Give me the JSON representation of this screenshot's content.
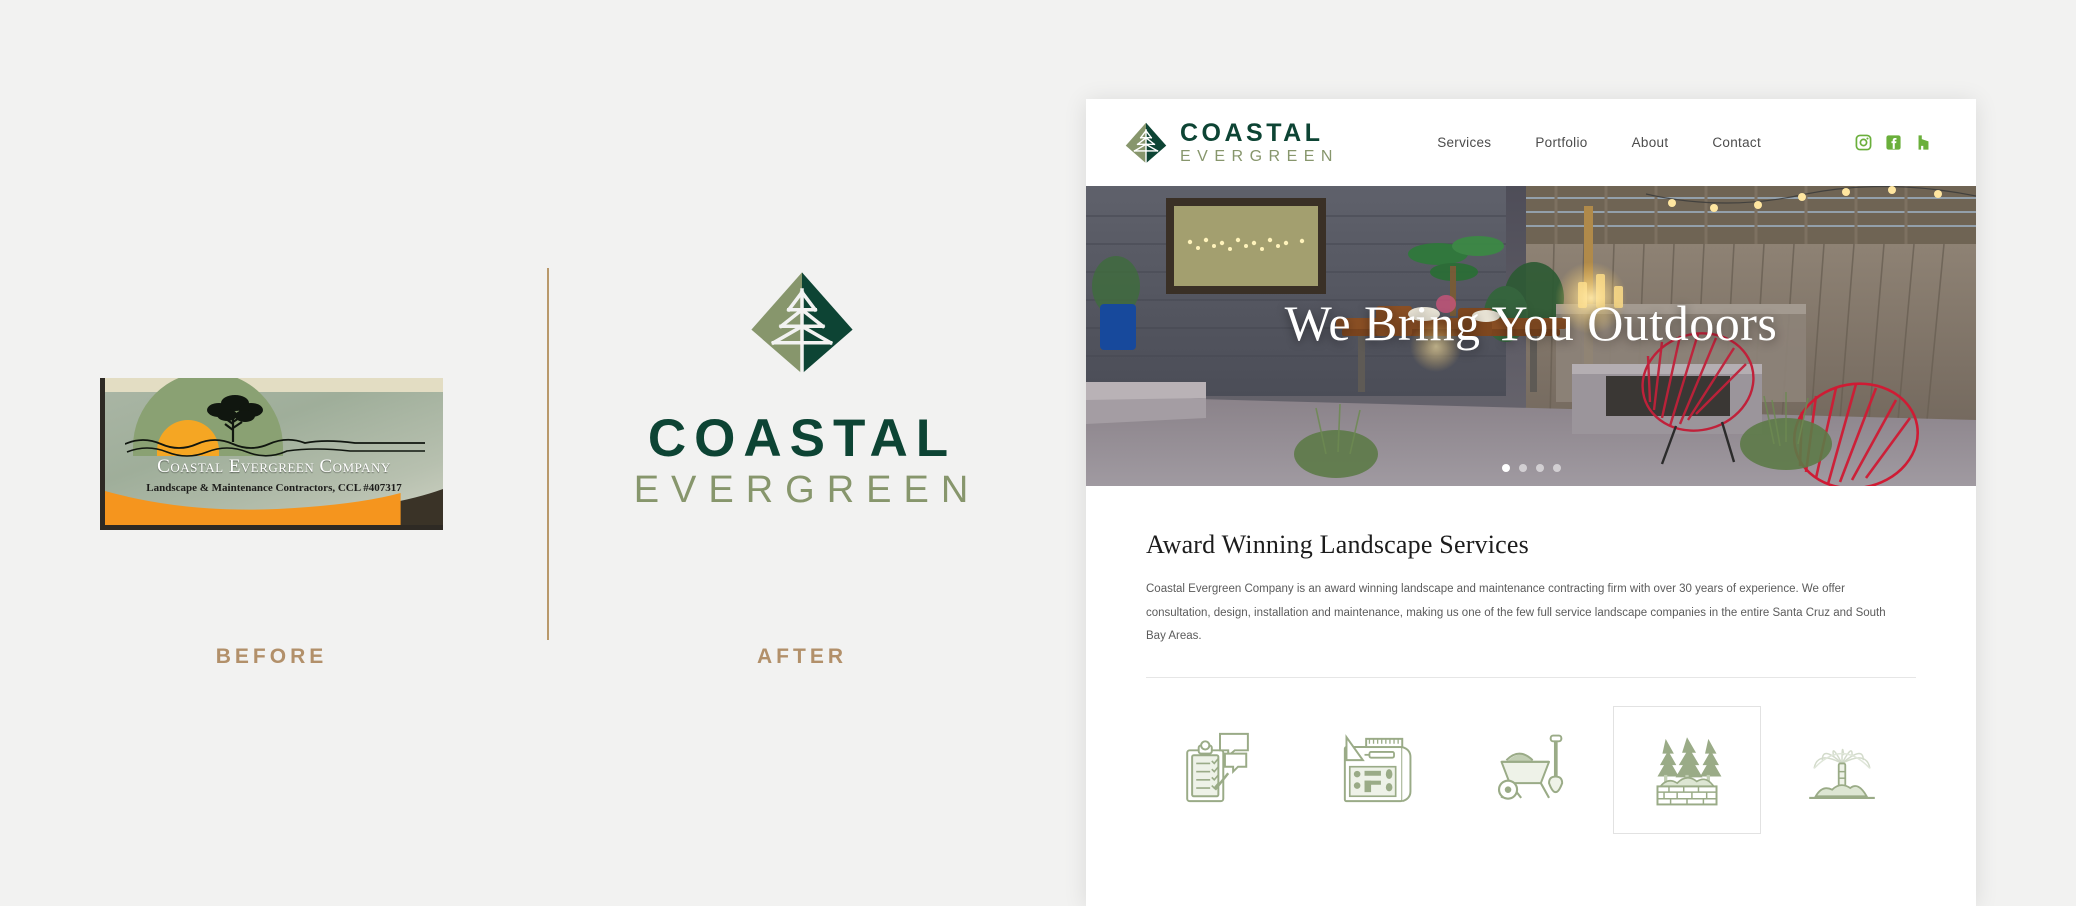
{
  "comparison": {
    "before": {
      "label": "BEFORE",
      "logo": {
        "company_name": "Coastal Evergreen Company",
        "tagline": "Landscape & Maintenance Contractors, CCL #407317"
      }
    },
    "after": {
      "label": "AFTER",
      "logo": {
        "mark": "evergreen-diamond-leaf-icon",
        "primary_text": "COASTAL",
        "secondary_text": "EVERGREEN",
        "colors": {
          "dark_green": "#0d4434",
          "sage_green": "#87966c"
        }
      }
    },
    "divider_color": "#b9996b",
    "label_color": "#b2906a",
    "background": "#f2f2f1"
  },
  "website": {
    "header": {
      "logo": {
        "mark": "evergreen-diamond-leaf-icon",
        "primary_text": "COASTAL",
        "secondary_text": "EVERGREEN"
      },
      "nav": [
        {
          "label": "Services",
          "name": "services"
        },
        {
          "label": "Portfolio",
          "name": "portfolio"
        },
        {
          "label": "About",
          "name": "about"
        },
        {
          "label": "Contact",
          "name": "contact"
        }
      ],
      "social": [
        {
          "icon": "instagram-icon",
          "label": "Instagram"
        },
        {
          "icon": "facebook-icon",
          "label": "Facebook"
        },
        {
          "icon": "houzz-icon",
          "label": "Houzz"
        }
      ],
      "social_color": "#6aaf3b"
    },
    "hero": {
      "headline": "We Bring You Outdoors",
      "image_description": "Backyard patio at dusk with string lights, wooden dining table, red acapulco chairs and a concrete fire pit",
      "carousel": {
        "total_slides": 4,
        "active_slide": 1
      }
    },
    "content": {
      "heading": "Award Winning Landscape Services",
      "paragraph": "Coastal Evergreen Company is an award winning landscape and maintenance contracting firm with over 30 years of experience. We offer consultation, design, installation and maintenance, making us one of the few full service landscape companies in the entire Santa Cruz and South Bay Areas.",
      "services": [
        {
          "icon": "clipboard-consultation-icon",
          "name": "consultation",
          "active": false
        },
        {
          "icon": "blueprint-design-icon",
          "name": "design",
          "active": false
        },
        {
          "icon": "wheelbarrow-installation-icon",
          "name": "installation",
          "active": false
        },
        {
          "icon": "trees-wall-planting-icon",
          "name": "planting",
          "active": true
        },
        {
          "icon": "sprinkler-irrigation-icon",
          "name": "irrigation",
          "active": false
        }
      ],
      "icon_color": "#9aab87"
    }
  }
}
